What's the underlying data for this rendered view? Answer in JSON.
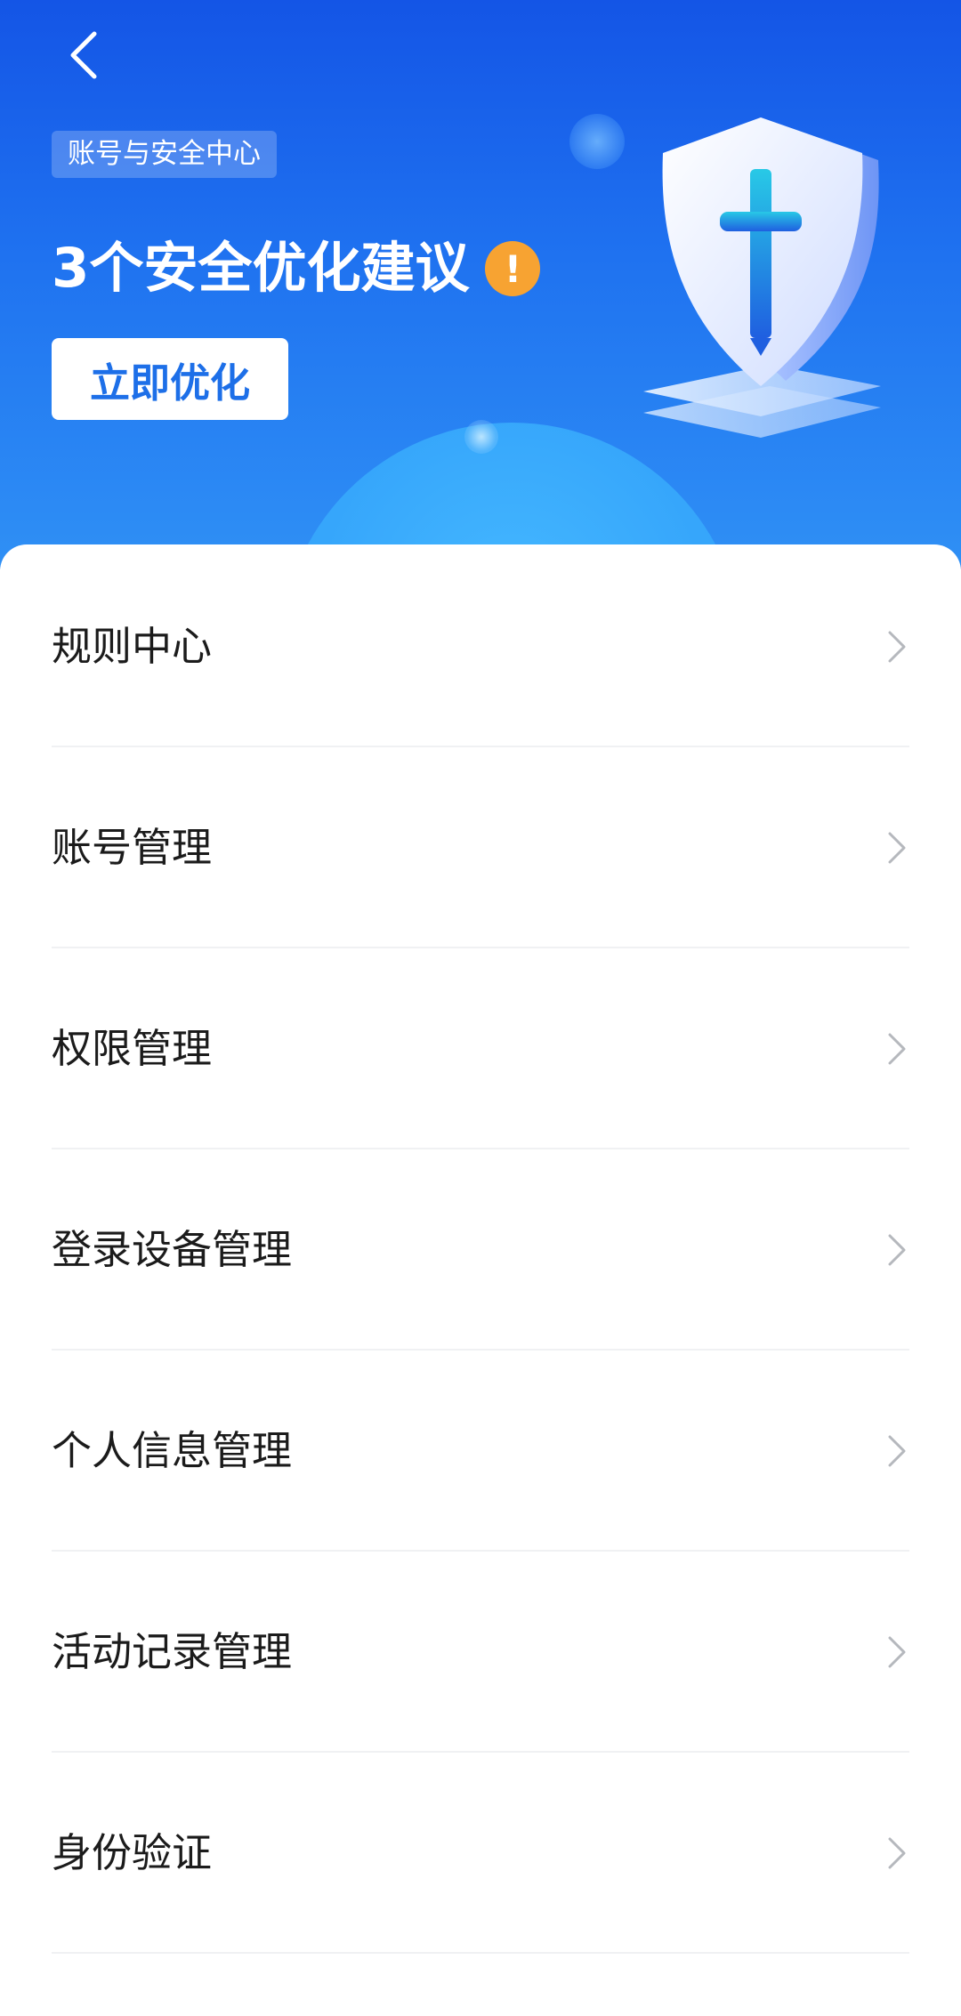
{
  "header": {
    "tag": "账号与安全中心",
    "headline": "3个安全优化建议",
    "warning_badge": "!",
    "optimize_button": "立即优化"
  },
  "icons": {
    "back": "chevron-left-icon",
    "warning": "exclamation-icon",
    "row_arrow": "chevron-right-icon",
    "illustration": "shield-icon"
  },
  "colors": {
    "hero_gradient_top": "#1455e6",
    "hero_gradient_bottom": "#2f90f5",
    "warning": "#f7a332",
    "accent_text": "#1d6fe8",
    "row_text": "#1b1b1b",
    "divider": "#f0f1f3"
  },
  "menu": [
    {
      "label": "规则中心"
    },
    {
      "label": "账号管理"
    },
    {
      "label": "权限管理"
    },
    {
      "label": "登录设备管理"
    },
    {
      "label": "个人信息管理"
    },
    {
      "label": "活动记录管理"
    },
    {
      "label": "身份验证"
    }
  ]
}
